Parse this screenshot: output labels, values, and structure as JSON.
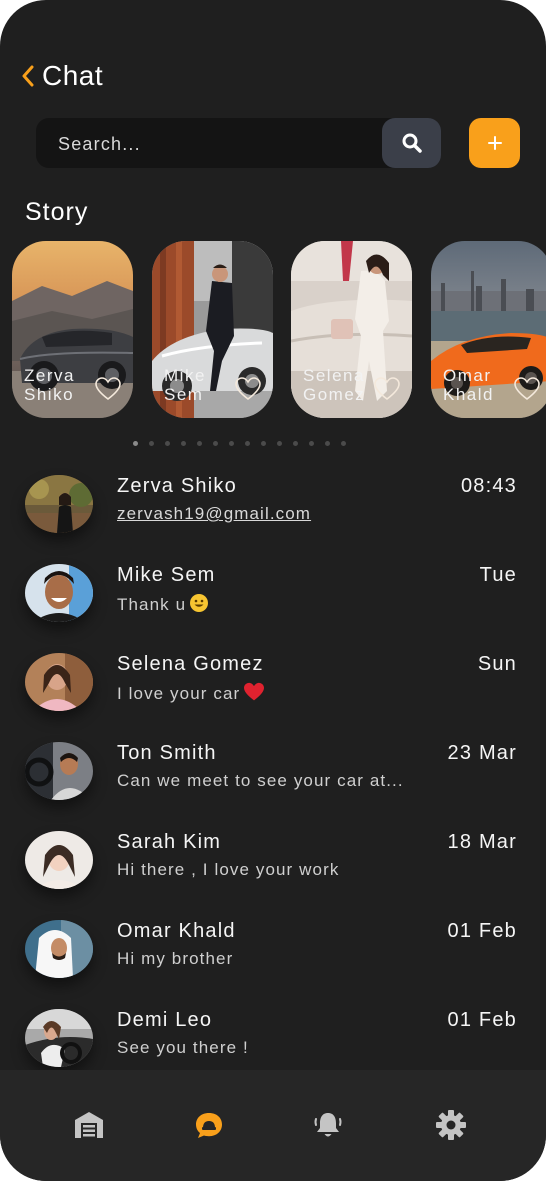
{
  "header": {
    "title": "Chat"
  },
  "search": {
    "placeholder": "Search..."
  },
  "stories": {
    "title": "Story",
    "items": [
      {
        "name": "Zerva\nShiko"
      },
      {
        "name": "Mike\nSem"
      },
      {
        "name": "Selena\nGomez"
      },
      {
        "name": "Omar\nKhald"
      }
    ],
    "pagination": {
      "count": 14,
      "active": 0
    }
  },
  "chats": [
    {
      "name": "Zerva Shiko",
      "message": "zervash19@gmail.com",
      "time": "08:43"
    },
    {
      "name": "Mike Sem",
      "message": "Thank u",
      "time": "Tue"
    },
    {
      "name": "Selena Gomez",
      "message": "I love your car",
      "time": "Sun"
    },
    {
      "name": "Ton Smith",
      "message": "Can we meet to see your car at...",
      "time": "23 Mar"
    },
    {
      "name": "Sarah Kim",
      "message": "Hi there , I love your work",
      "time": "18 Mar"
    },
    {
      "name": "Omar Khald",
      "message": "Hi my brother",
      "time": "01 Feb"
    },
    {
      "name": "Demi Leo",
      "message": "See you there !",
      "time": "01 Feb"
    }
  ],
  "bottom_nav": {
    "items": [
      {
        "icon": "garage-icon",
        "active": false
      },
      {
        "icon": "chat-icon",
        "active": true
      },
      {
        "icon": "bell-icon",
        "active": false
      },
      {
        "icon": "settings-icon",
        "active": false
      }
    ]
  },
  "colors": {
    "accent": "#f9a01b",
    "background": "#1f1f1f",
    "nav": "#262626",
    "search_button": "#3b3f49"
  }
}
